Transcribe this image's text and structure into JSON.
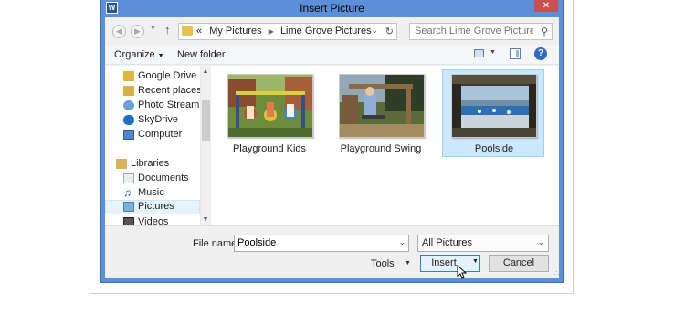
{
  "window": {
    "title": "Insert Picture",
    "app_icon": "W",
    "close_glyph": "✕"
  },
  "address": {
    "crumbs_prefix": "«",
    "crumbs": [
      "My Pictures",
      "Lime Grove Pictures"
    ]
  },
  "search": {
    "placeholder": "Search Lime Grove Pictures"
  },
  "toolbar": {
    "organize": "Organize",
    "new_folder": "New folder",
    "help": "?"
  },
  "nav": {
    "items": [
      {
        "label": "Google Drive",
        "icon": "google-drive-icon"
      },
      {
        "label": "Recent places",
        "icon": "recent-places-icon"
      },
      {
        "label": "Photo Stream",
        "icon": "photo-stream-icon"
      },
      {
        "label": "SkyDrive",
        "icon": "skydrive-icon"
      },
      {
        "label": "Computer",
        "icon": "computer-icon"
      },
      {
        "label": "Libraries",
        "icon": "libraries-icon"
      },
      {
        "label": "Documents",
        "icon": "documents-icon"
      },
      {
        "label": "Music",
        "icon": "music-icon"
      },
      {
        "label": "Pictures",
        "icon": "pictures-icon"
      },
      {
        "label": "Videos",
        "icon": "videos-icon"
      }
    ],
    "selected": "Pictures"
  },
  "files": [
    {
      "label": "Playground Kids"
    },
    {
      "label": "Playground Swing"
    },
    {
      "label": "Poolside"
    }
  ],
  "selected_file": "Poolside",
  "bottom": {
    "file_name_label": "File name:",
    "file_name_value": "Poolside",
    "file_type": "All Pictures",
    "tools": "Tools",
    "insert": "Insert",
    "cancel": "Cancel"
  },
  "colors": {
    "title_bar": "#5b8fd8",
    "close": "#c75050",
    "selection": "#cce8ff"
  }
}
